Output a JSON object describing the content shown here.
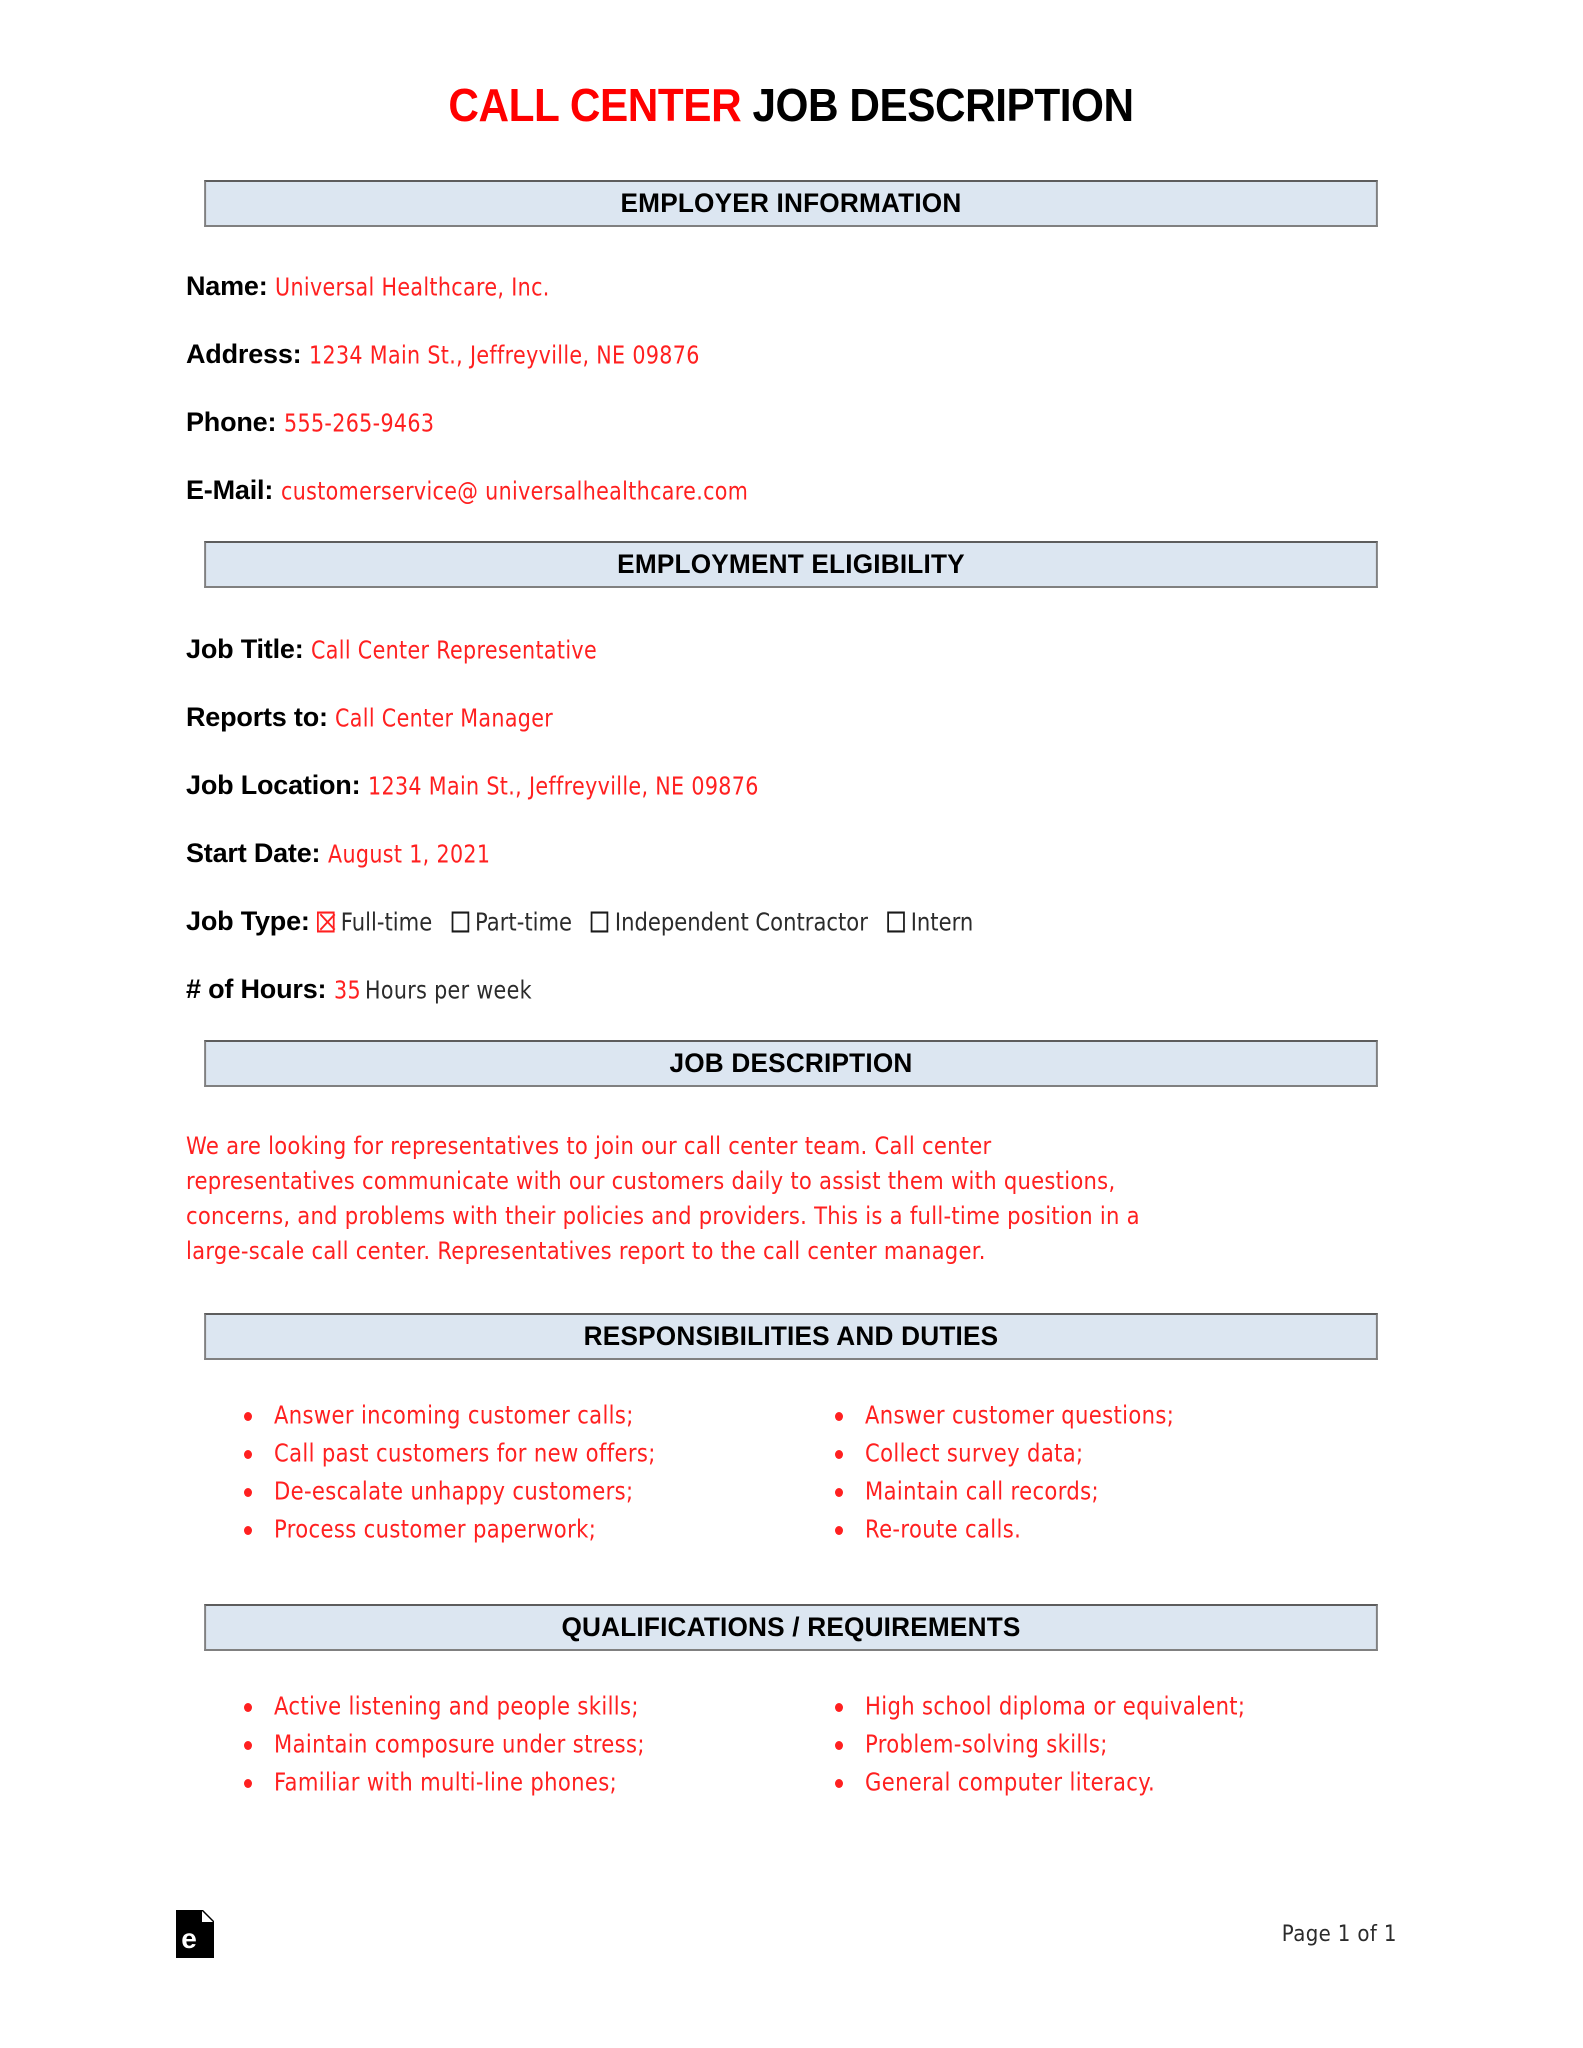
{
  "title": {
    "accent": "CALL CENTER",
    "rest": "JOB DESCRIPTION"
  },
  "colors": {
    "accent_red": "#ff2020",
    "section_bar_bg": "#dce6f1",
    "section_bar_border": "#808080",
    "text_black": "#000000"
  },
  "sections": {
    "employer_information": {
      "heading": "EMPLOYER INFORMATION",
      "fields": [
        {
          "label": "Name",
          "value": "Universal Healthcare, Inc."
        },
        {
          "label": "Address",
          "value": "1234 Main St., Jeffreyville, NE 09876"
        },
        {
          "label": "Phone",
          "value": "555-265-9463"
        },
        {
          "label": "E-Mail",
          "value": "customerservice@ universalhealthcare.com"
        }
      ]
    },
    "employment_eligibility": {
      "heading": "EMPLOYMENT ELIGIBILITY",
      "fields": [
        {
          "label": "Job Title",
          "value": "Call Center Representative"
        },
        {
          "label": "Reports to",
          "value": "Call Center Manager"
        },
        {
          "label": "Job Location",
          "value": "1234 Main St., Jeffreyville, NE 09876"
        },
        {
          "label": "Start Date",
          "value": "August 1, 2021"
        }
      ],
      "job_type": {
        "label": "Job Type",
        "options": [
          {
            "label": "Full-time",
            "checked": true
          },
          {
            "label": "Part-time",
            "checked": false
          },
          {
            "label": "Independent Contractor",
            "checked": false
          },
          {
            "label": "Intern",
            "checked": false
          }
        ]
      },
      "hours": {
        "label": "# of Hours",
        "value": "35",
        "suffix": "Hours per week"
      }
    },
    "job_description": {
      "heading": "JOB DESCRIPTION",
      "body": "We are looking for representatives to join our call center team. Call center representatives communicate with our customers daily to assist them with questions, concerns, and problems with their policies and providers. This is a full-time position in a large-scale call center. Representatives report to the call center manager."
    },
    "responsibilities": {
      "heading": "RESPONSIBILITIES AND DUTIES",
      "left": [
        "Answer incoming customer calls;",
        "Call past customers for new offers;",
        "De-escalate unhappy customers;",
        "Process customer paperwork;"
      ],
      "right": [
        "Answer customer questions;",
        "Collect survey data;",
        "Maintain call records;",
        "Re-route calls."
      ]
    },
    "qualifications": {
      "heading": "QUALIFICATIONS / REQUIREMENTS",
      "left": [
        "Active listening and people skills;",
        "Maintain composure under stress;",
        "Familiar with multi-line phones;"
      ],
      "right": [
        "High school diploma or equivalent;",
        "Problem-solving skills;",
        "General computer literacy."
      ]
    }
  },
  "footer": {
    "logo_letter": "e",
    "page_number": "Page 1 of 1"
  }
}
